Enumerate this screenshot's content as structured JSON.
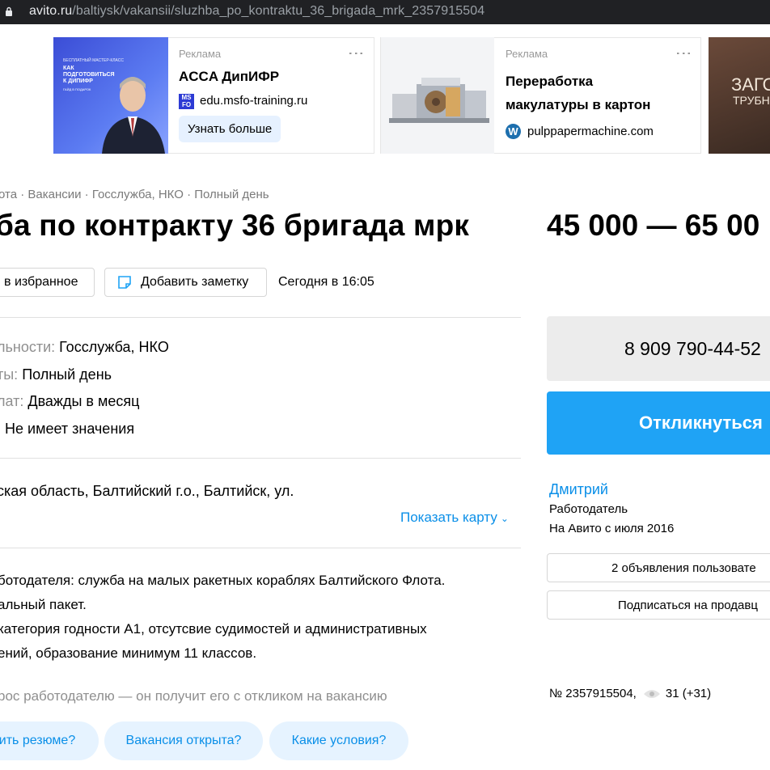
{
  "browser": {
    "url_host": "avito.ru",
    "url_path": "/baltiysk/vakansii/sluzhba_po_kontraktu_36_brigada_mrk_2357915504"
  },
  "ads": [
    {
      "label": "Реклама",
      "title": "ACCA ДипИФР",
      "domain": "edu.msfo-training.ru",
      "button": "Узнать больше",
      "image_text": [
        "БЕСПЛАТНЫЙ МАСТЕР-КЛАСС",
        "КАК",
        "ПОДГОТОВИТЬСЯ",
        "К ДИПИФР",
        "ГАЙД В ПОДАРОК"
      ],
      "favicon_text": "MS FO"
    },
    {
      "label": "Реклама",
      "title_line1": "Переработка",
      "title_line2": "макулатуры в картон",
      "domain": "pulppapermachine.com"
    },
    {
      "image_text_1": "ЗАГО",
      "image_text_2": "ТРУБН"
    }
  ],
  "breadcrumbs": "ота · Вакансии · Госслужба, НКО · Полный день",
  "title": "ба по контракту 36 бригада мрк",
  "price": "45 000 — 65 00",
  "actions": {
    "favorite": "в избранное",
    "note": "Добавить заметку",
    "date": "Сегодня в 16:05"
  },
  "params": [
    {
      "key": "льности: ",
      "value": "Госслужба, НКО"
    },
    {
      "key": "ты: ",
      "value": "Полный день"
    },
    {
      "key": "лат: ",
      "value": "Дважды в месяц"
    },
    {
      "key": ": ",
      "value": "Не имеет значения"
    }
  ],
  "address": "ская область, Балтийский г.о., Балтийск, ул.",
  "show_map": "Показать карту",
  "description": [
    "ботодателя: служба на малых ракетных кораблях Балтийского Флота.",
    "альный пакет.",
    "категория годности А1, отсутсвие судимостей и административных",
    "ений, образование минимум 11 классов."
  ],
  "question_prompt": "рос работодателю — он получит его с откликом на вакансию",
  "question_pills": [
    "ить резюме?",
    "Вакансия открыта?",
    "Какие условия?"
  ],
  "sidebar": {
    "phone": "8 909 790-44-52",
    "respond": "Откликнуться",
    "seller_name": "Дмитрий",
    "seller_role": "Работодатель",
    "seller_since": "На Авито с июля 2016",
    "ads_button": "2 объявления пользовате",
    "subscribe_button": "Подписаться на продавц",
    "listing_number": "№ 2357915504,",
    "views": "31 (+31)"
  },
  "colors": {
    "accent": "#1fa3f5",
    "link": "#0a8fe8",
    "pill_bg": "#e6f3ff"
  }
}
